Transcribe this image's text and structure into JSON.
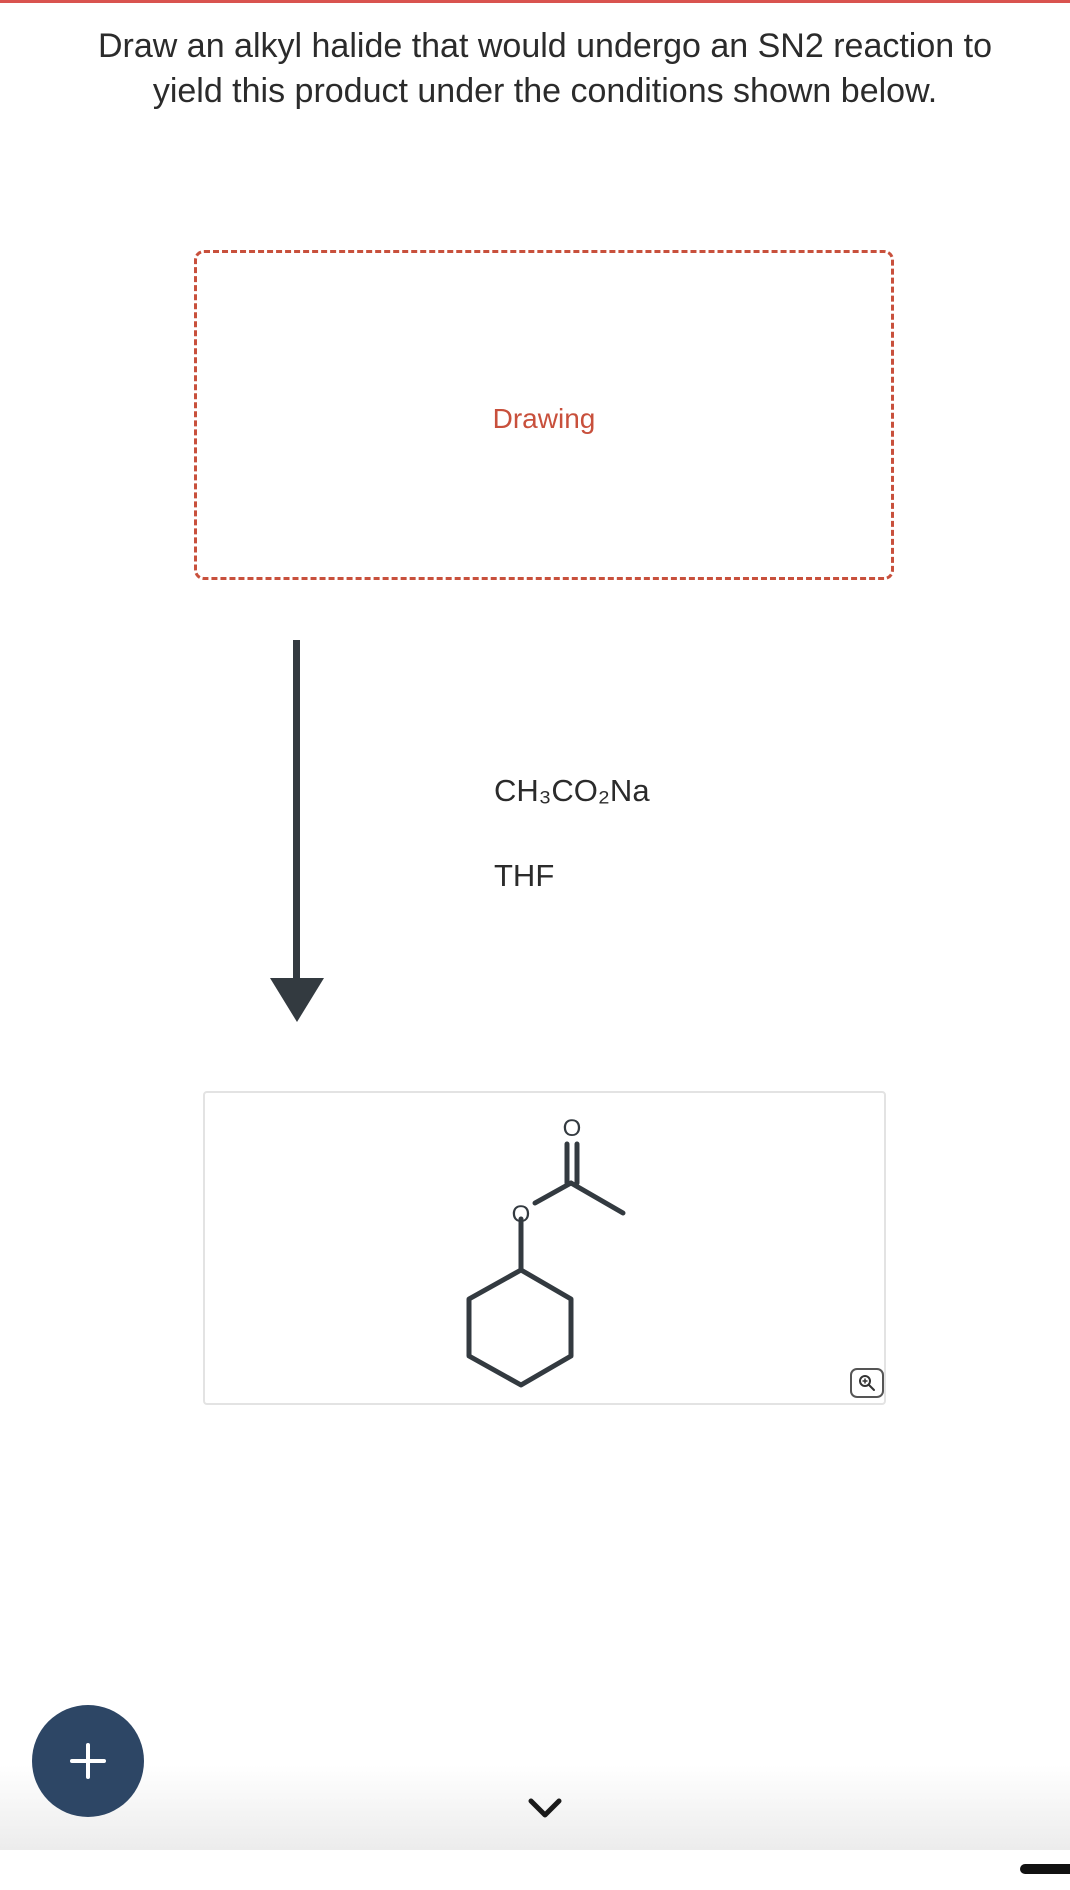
{
  "question": {
    "text": "Draw an alkyl halide that would undergo an SN2 reaction to yield this product under the conditions shown below."
  },
  "drawing_area": {
    "label": "Drawing"
  },
  "reaction": {
    "reagents": [
      "CH₃CO₂Na",
      "THF"
    ]
  },
  "product": {
    "atoms": {
      "carbonyl_oxygen": "O",
      "ester_oxygen": "O"
    },
    "zoom_icon": "zoom-in-icon"
  },
  "controls": {
    "add_icon": "plus-icon",
    "next_icon": "chevron-down-icon"
  },
  "colors": {
    "accent": "#c8503c",
    "top_bar": "#d9534f",
    "button": "#2d4665",
    "text": "#2b2b2b",
    "arrow": "#333a40"
  }
}
